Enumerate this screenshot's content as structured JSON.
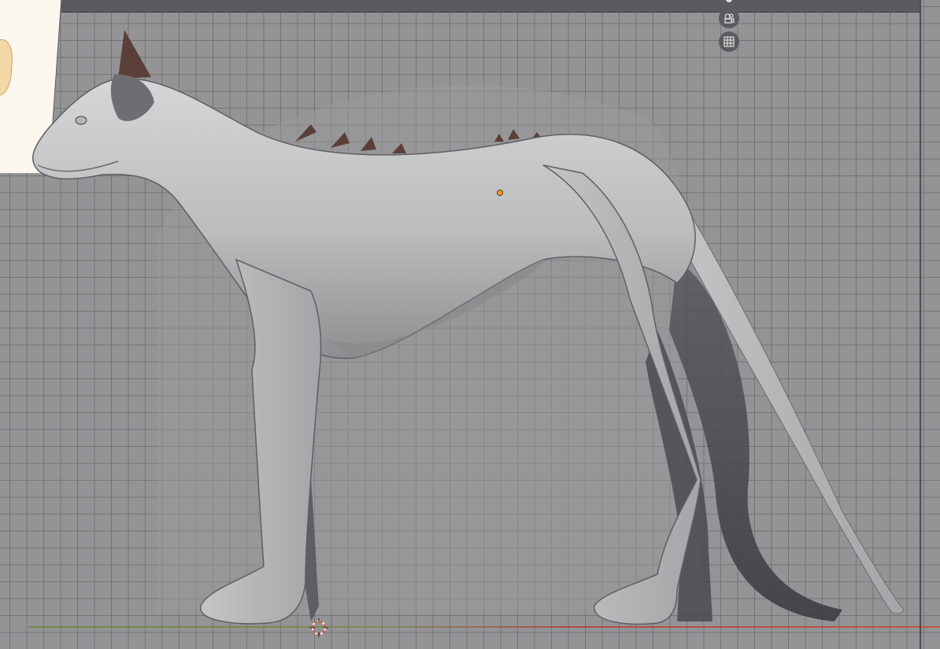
{
  "app": {
    "name": "",
    "viewport_mode": ""
  },
  "viewport": {
    "background_color": "#949496",
    "grid_color": "#3c3c3e",
    "floor_line_colors": [
      "#6d8a3f",
      "#c05545"
    ]
  },
  "overlay_buttons": [
    {
      "name": "toggle-view-icon",
      "icon": "circle-icon"
    },
    {
      "name": "camera-view-icon",
      "icon": "camera-icon"
    },
    {
      "name": "grid-view-icon",
      "icon": "grid-icon"
    }
  ],
  "scene": {
    "object": "creature-mesh",
    "mesh_color": "#c9c9cb",
    "spine_color": "#5a3f38",
    "origin_color": "#f39a1f",
    "cursor_color": "#d94c3c"
  }
}
